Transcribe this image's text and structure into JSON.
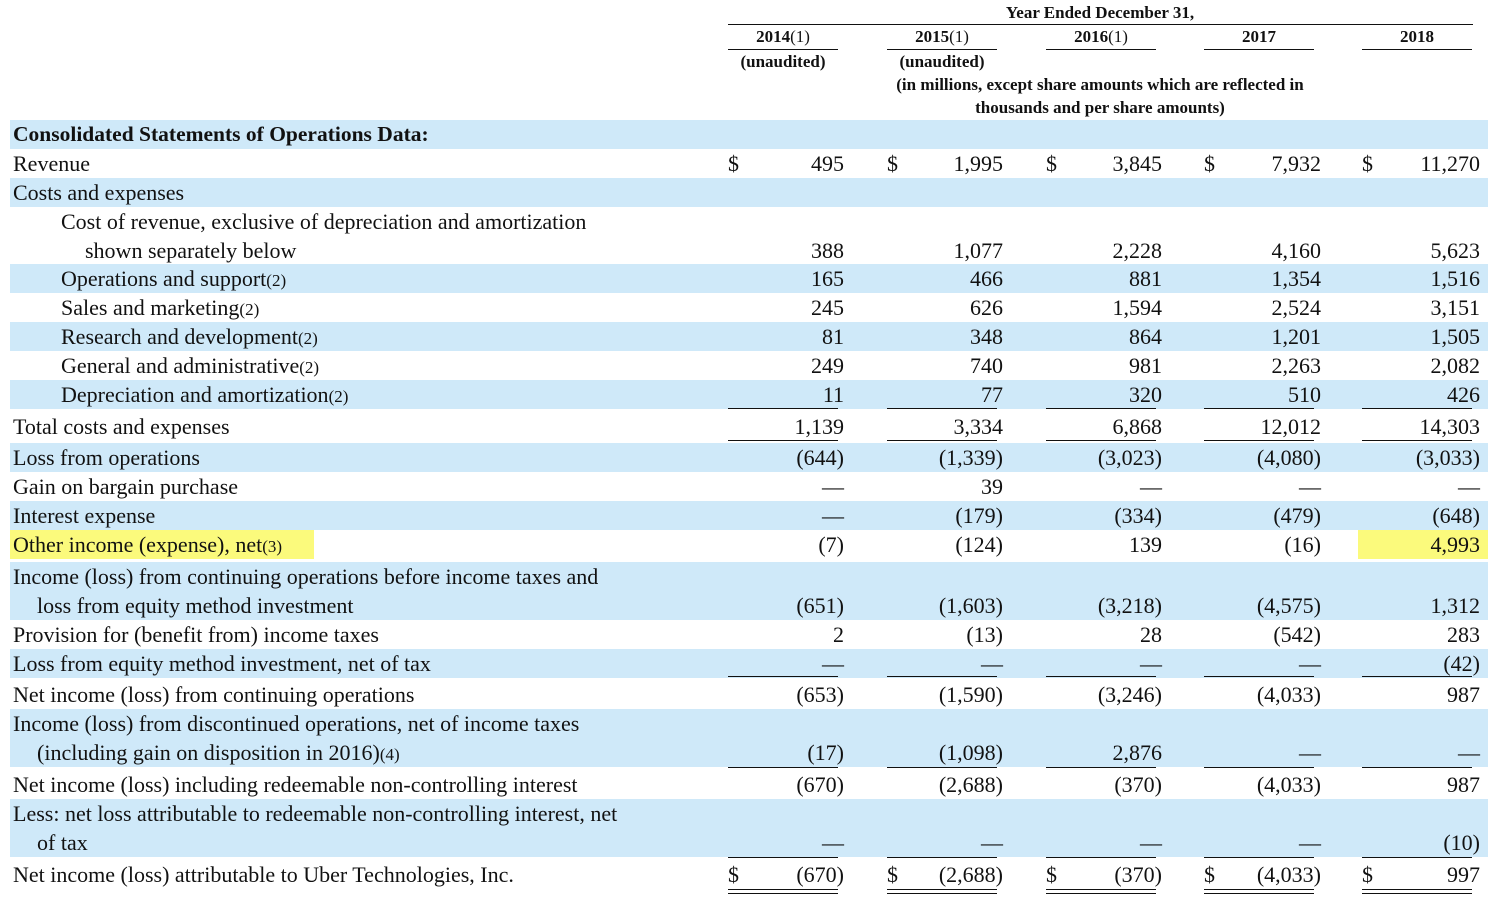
{
  "header": {
    "year_ended": "Year Ended December 31,",
    "columns": [
      {
        "year": "2014",
        "note": "(1)",
        "sub": "(unaudited)"
      },
      {
        "year": "2015",
        "note": "(1)",
        "sub": "(unaudited)"
      },
      {
        "year": "2016",
        "note": "(1)",
        "sub": ""
      },
      {
        "year": "2017",
        "note": "",
        "sub": ""
      },
      {
        "year": "2018",
        "note": "",
        "sub": ""
      }
    ],
    "units_line1": "(in millions, except share amounts which are reflected in",
    "units_line2": "thousands and per share amounts)"
  },
  "section_title": "Consolidated Statements of Operations Data:",
  "rows": [
    {
      "label": "Revenue",
      "note": "",
      "values": [
        "495",
        "1,995",
        "3,845",
        "7,932",
        "11,270"
      ],
      "dollar": true
    },
    {
      "label": "Costs and expenses",
      "note": "",
      "values": [
        "",
        "",
        "",
        "",
        ""
      ]
    },
    {
      "label": "Cost of revenue, exclusive of depreciation and amortization",
      "label2": "shown separately below",
      "note": "",
      "values": [
        "388",
        "1,077",
        "2,228",
        "4,160",
        "5,623"
      ]
    },
    {
      "label": "Operations and support",
      "note": "(2)",
      "values": [
        "165",
        "466",
        "881",
        "1,354",
        "1,516"
      ]
    },
    {
      "label": "Sales and marketing",
      "note": "(2)",
      "values": [
        "245",
        "626",
        "1,594",
        "2,524",
        "3,151"
      ]
    },
    {
      "label": "Research and development",
      "note": "(2)",
      "values": [
        "81",
        "348",
        "864",
        "1,201",
        "1,505"
      ]
    },
    {
      "label": "General and administrative",
      "note": "(2)",
      "values": [
        "249",
        "740",
        "981",
        "2,263",
        "2,082"
      ]
    },
    {
      "label": "Depreciation and amortization",
      "note": "(2)",
      "values": [
        "11",
        "77",
        "320",
        "510",
        "426"
      ]
    },
    {
      "label": "Total costs and expenses",
      "note": "",
      "values": [
        "1,139",
        "3,334",
        "6,868",
        "12,012",
        "14,303"
      ]
    },
    {
      "label": "Loss from operations",
      "note": "",
      "values": [
        "(644)",
        "(1,339)",
        "(3,023)",
        "(4,080)",
        "(3,033)"
      ]
    },
    {
      "label": "Gain on bargain purchase",
      "note": "",
      "values": [
        "—",
        "39",
        "—",
        "—",
        "—"
      ]
    },
    {
      "label": "Interest expense",
      "note": "",
      "values": [
        "—",
        "(179)",
        "(334)",
        "(479)",
        "(648)"
      ]
    },
    {
      "label": "Other income (expense), net",
      "note": "(3)",
      "values": [
        "(7)",
        "(124)",
        "139",
        "(16)",
        "4,993"
      ]
    },
    {
      "label": "Income (loss) from continuing operations before income taxes and",
      "label2": "loss from equity method investment",
      "note": "",
      "values": [
        "(651)",
        "(1,603)",
        "(3,218)",
        "(4,575)",
        "1,312"
      ]
    },
    {
      "label": "Provision for (benefit from) income taxes",
      "note": "",
      "values": [
        "2",
        "(13)",
        "28",
        "(542)",
        "283"
      ]
    },
    {
      "label": "Loss from equity method investment, net of tax",
      "note": "",
      "values": [
        "—",
        "—",
        "—",
        "—",
        "(42)"
      ]
    },
    {
      "label": "Net income (loss) from continuing operations",
      "note": "",
      "values": [
        "(653)",
        "(1,590)",
        "(3,246)",
        "(4,033)",
        "987"
      ]
    },
    {
      "label": "Income (loss) from discontinued operations, net of income taxes",
      "label2": "(including gain on disposition in 2016)",
      "note": "(4)",
      "values": [
        "(17)",
        "(1,098)",
        "2,876",
        "—",
        "—"
      ]
    },
    {
      "label": "Net income (loss) including redeemable non-controlling interest",
      "note": "",
      "values": [
        "(670)",
        "(2,688)",
        "(370)",
        "(4,033)",
        "987"
      ]
    },
    {
      "label": "Less: net loss attributable to redeemable non-controlling interest, net",
      "label2": "of tax",
      "note": "",
      "values": [
        "—",
        "—",
        "—",
        "—",
        "(10)"
      ]
    },
    {
      "label": "Net income (loss) attributable to Uber Technologies, Inc.",
      "note": "",
      "values": [
        "(670)",
        "(2,688)",
        "(370)",
        "(4,033)",
        "997"
      ],
      "dollar": true
    }
  ],
  "currency_symbol": "$",
  "highlight_color": "#fbfa7c",
  "band_color": "#cfe9f9"
}
